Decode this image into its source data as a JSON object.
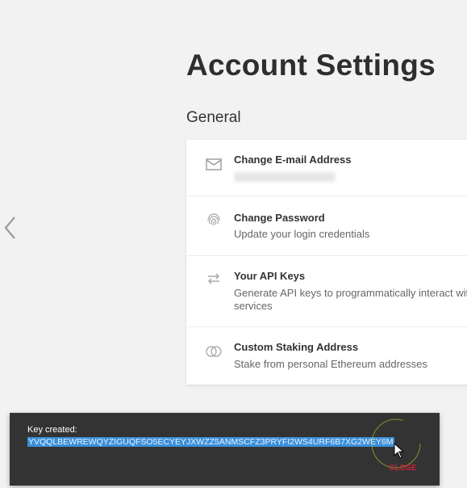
{
  "page": {
    "title": "Account Settings",
    "section": "General"
  },
  "settings": [
    {
      "label": "Change E-mail Address",
      "description": "",
      "icon": "mail-icon"
    },
    {
      "label": "Change Password",
      "description": "Update your login credentials",
      "icon": "fingerprint-icon"
    },
    {
      "label": "Your API Keys",
      "description": "Generate API keys to programmatically interact with services",
      "icon": "swap-arrows-icon"
    },
    {
      "label": "Custom Staking Address",
      "description": "Stake from personal Ethereum addresses",
      "icon": "toggle-circles-icon"
    }
  ],
  "toast": {
    "title": "Key created:",
    "key": "YVQQLBEWREWQYZIGUQFSO5ECYEYJXWZZ5ANMSCFZ3PRYFI2WS4URF6B7XG2WEY6M",
    "close_label": "CLOSE"
  },
  "colors": {
    "background": "#f2f2f2",
    "card": "#ffffff",
    "toast_bg": "#333333",
    "selection": "#3b8fd9",
    "close": "#c9213b",
    "spinner": "#a8b832"
  }
}
